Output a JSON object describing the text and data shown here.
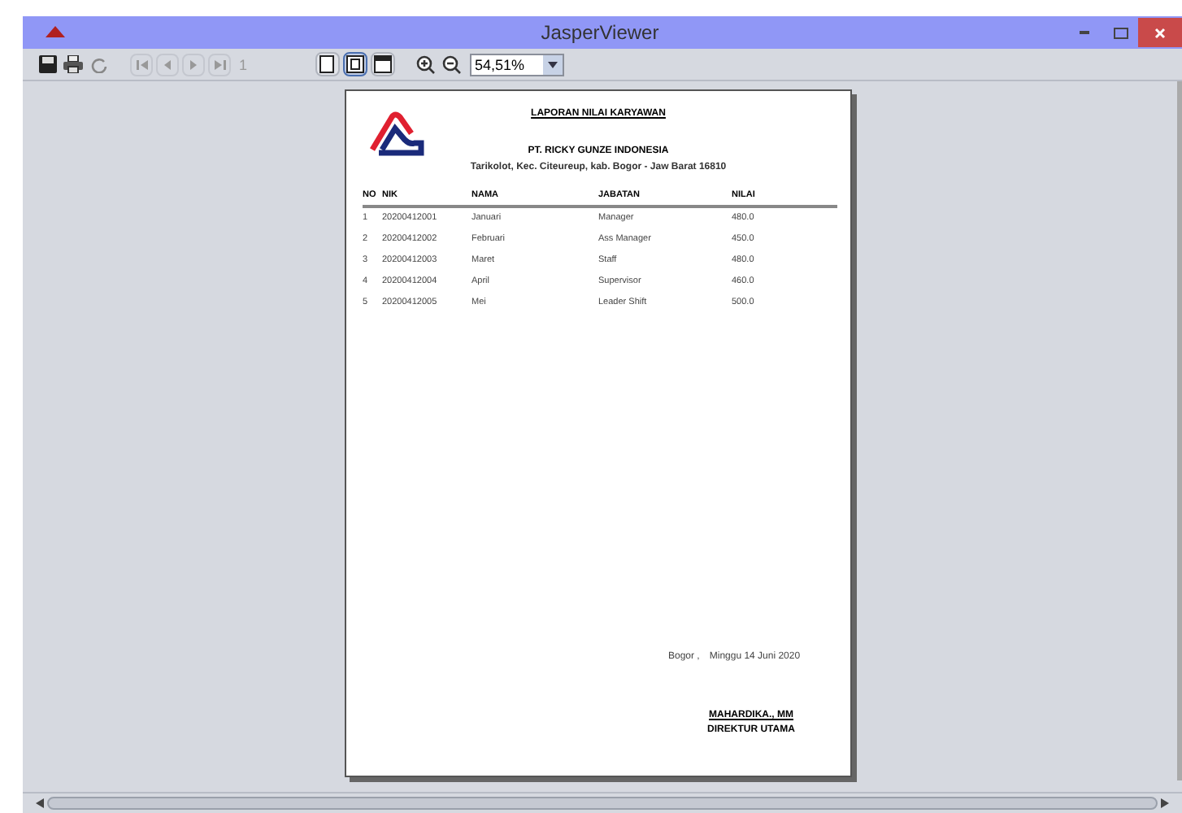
{
  "window": {
    "title": "JasperViewer"
  },
  "toolbar": {
    "page_number": "1",
    "zoom": "54,51%",
    "view_modes": [
      {
        "selected": false
      },
      {
        "selected": true
      },
      {
        "selected": false
      }
    ]
  },
  "report": {
    "title": "LAPORAN NILAI KARYAWAN",
    "company": "PT. RICKY GUNZE INDONESIA",
    "address": "Tarikolot, Kec. Citeureup, kab. Bogor - Jaw Barat 16810",
    "columns": [
      "NO",
      "NIK",
      "NAMA",
      "JABATAN",
      "NILAI"
    ],
    "rows": [
      [
        "1",
        "20200412001",
        "Januari",
        "Manager",
        "480.0"
      ],
      [
        "2",
        "20200412002",
        "Februari",
        "Ass Manager",
        "450.0"
      ],
      [
        "3",
        "20200412003",
        "Maret",
        "Staff",
        "480.0"
      ],
      [
        "4",
        "20200412004",
        "April",
        "Supervisor",
        "460.0"
      ],
      [
        "5",
        "20200412005",
        "Mei",
        "Leader Shift",
        "500.0"
      ]
    ],
    "place": "Bogor ,",
    "date": "Minggu 14 Juni 2020",
    "signatory": "MAHARDIKA., MM",
    "position": "DIREKTUR UTAMA"
  }
}
